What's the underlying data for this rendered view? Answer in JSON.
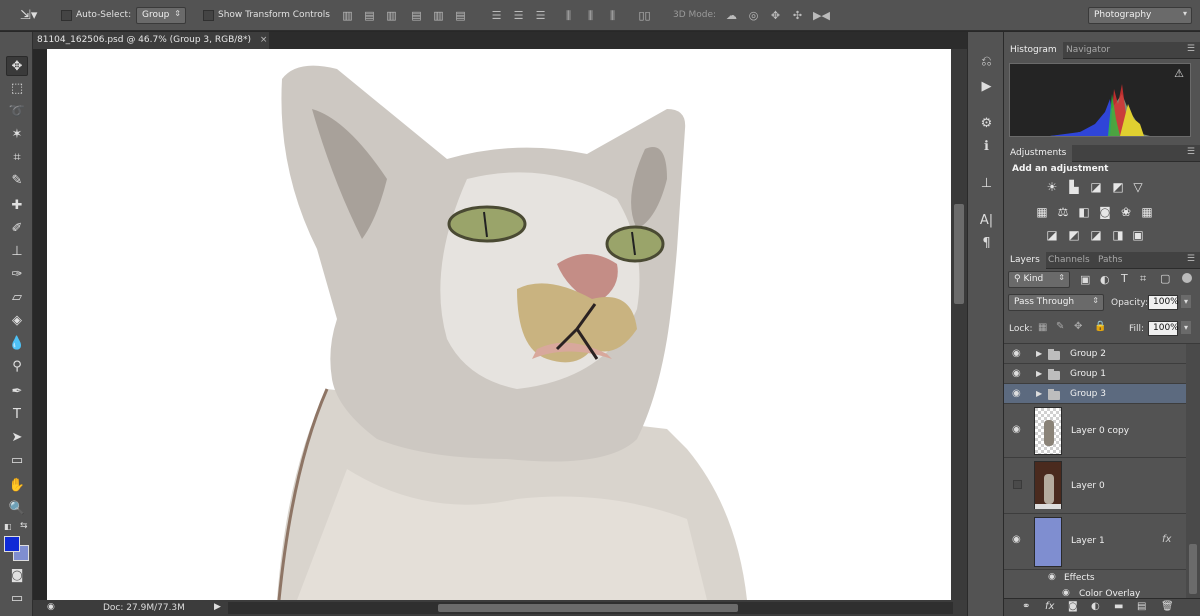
{
  "options_bar": {
    "auto_select_label": "Auto-Select:",
    "auto_select_value": "Group",
    "transform_label": "Show Transform Controls",
    "mode_3d_label": "3D Mode:",
    "workspace": "Photography"
  },
  "document": {
    "tab_title": "81104_162506.psd @ 46.7% (Group 3, RGB/8*)",
    "tab_close": "×",
    "status_doc": "Doc: 27.9M/77.3M"
  },
  "panels": {
    "histogram_tab": "Histogram",
    "navigator_tab": "Navigator",
    "adjustments_tab": "Adjustments",
    "adjustments_title": "Add an adjustment",
    "layers_tab": "Layers",
    "channels_tab": "Channels",
    "paths_tab": "Paths",
    "kind_filter": "Kind",
    "blend_mode": "Pass Through",
    "opacity_label": "Opacity:",
    "opacity_value": "100%",
    "lock_label": "Lock:",
    "fill_label": "Fill:",
    "fill_value": "100%"
  },
  "layers": [
    {
      "name": "Group 2",
      "type": "group",
      "visible": true
    },
    {
      "name": "Group 1",
      "type": "group",
      "visible": true
    },
    {
      "name": "Group 3",
      "type": "group",
      "visible": true,
      "selected": true
    },
    {
      "name": "Layer 0 copy",
      "type": "layer",
      "visible": true
    },
    {
      "name": "Layer 0",
      "type": "layer",
      "visible": false
    },
    {
      "name": "Layer 1",
      "type": "layer",
      "visible": true,
      "fx": "fx"
    }
  ],
  "effects": {
    "label": "Effects",
    "item": "Color Overlay"
  },
  "colors": {
    "foreground": "#0f2ad6",
    "background": "#7f8ed0",
    "accent_selected": "#5c6a7f"
  }
}
